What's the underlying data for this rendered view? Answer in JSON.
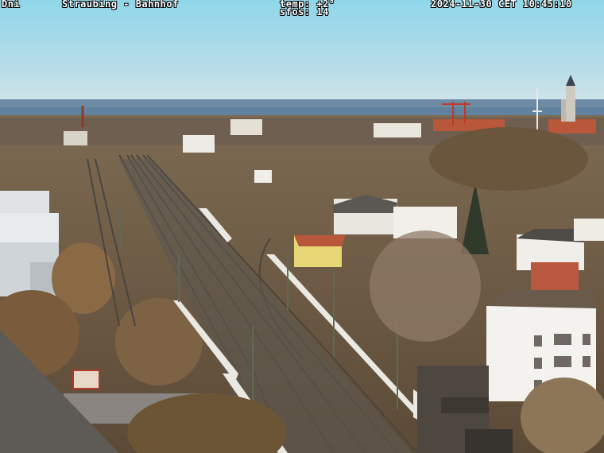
{
  "overlay": {
    "left_code": "Dni",
    "title": "Straubing - Bahnhof",
    "temperature": "temp: +2°",
    "sfos": "sfos: 14",
    "timestamp": "2024-11-30 CET 10:45:10"
  },
  "colors": {
    "sky_top": "#8fd7ea",
    "sky_horizon": "#c9e0ea",
    "haze": "#4c6a8a",
    "ground": "#6b5a44",
    "rail": "#5a564f",
    "wall": "#e8e6e0",
    "roof_red": "#b8573a",
    "vegetation": "#8a6a45"
  }
}
